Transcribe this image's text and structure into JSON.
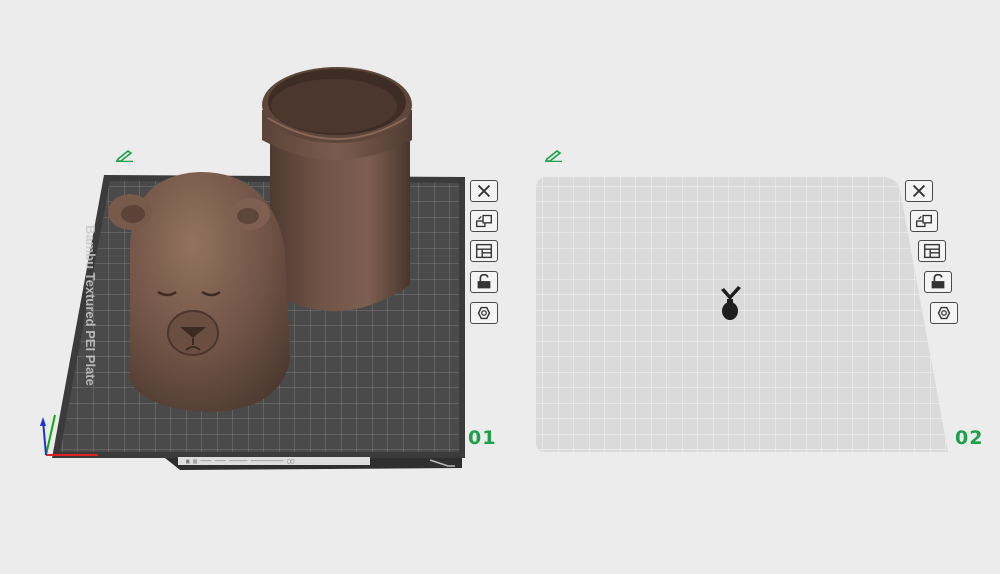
{
  "colors": {
    "accent": "#1aa14a",
    "plate_dark": "#3d3d3d",
    "plate_light": "#dcdcdc",
    "model_brown": "#6e5244",
    "background": "#ececec"
  },
  "plates": [
    {
      "number": "01",
      "label": "Bambu Textured PEI Plate",
      "edit_icon": "pencil-icon",
      "tools": [
        {
          "name": "delete-plate",
          "icon": "close-icon"
        },
        {
          "name": "arrange-plate",
          "icon": "arrange-icon"
        },
        {
          "name": "plate-settings",
          "icon": "layout-icon"
        },
        {
          "name": "lock-plate",
          "icon": "unlock-icon"
        },
        {
          "name": "slice-plate",
          "icon": "hex-nut-icon"
        }
      ],
      "objects": [
        "bear-head-model",
        "cylinder-container-model"
      ]
    },
    {
      "number": "02",
      "edit_icon": "pencil-icon",
      "tools": [
        {
          "name": "delete-plate",
          "icon": "close-icon"
        },
        {
          "name": "arrange-plate",
          "icon": "arrange-icon"
        },
        {
          "name": "plate-settings",
          "icon": "layout-icon"
        },
        {
          "name": "lock-plate",
          "icon": "unlock-icon"
        },
        {
          "name": "slice-plate",
          "icon": "hex-nut-icon"
        }
      ],
      "objects": [
        "small-figure-model"
      ]
    }
  ]
}
